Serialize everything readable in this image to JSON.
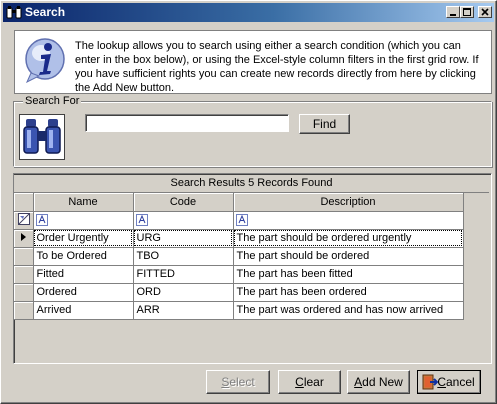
{
  "window": {
    "title": "Search",
    "icon": "binoculars-icon",
    "controls": [
      "minimize-icon",
      "maximize-icon",
      "close-icon"
    ]
  },
  "info": {
    "icon": "info-icon",
    "text": "The lookup allows you to search using either a search condition (which you can enter in the box below), or using the Excel-style column filters in the first grid row. If you have sufficient rights you can create new records directly from here by clicking the Add New button."
  },
  "search": {
    "group_label": "Search For",
    "input_value": "",
    "find_label": "Find",
    "binoculars_icon": "binoculars-icon"
  },
  "results": {
    "header": "Search Results 5 Records Found",
    "columns": [
      "Name",
      "Code",
      "Description"
    ],
    "filter_icon": "filter-icon",
    "rows": [
      {
        "name": "Order Urgently",
        "code": "URG",
        "description": "The part should be ordered urgently"
      },
      {
        "name": "To be Ordered",
        "code": "TBO",
        "description": "The part should be ordered"
      },
      {
        "name": "Fitted",
        "code": "FITTED",
        "description": "The part has been fitted"
      },
      {
        "name": "Ordered",
        "code": "ORD",
        "description": "The part has been ordered"
      },
      {
        "name": "Arrived",
        "code": "ARR",
        "description": "The part was ordered and has now arrived"
      }
    ],
    "current_row": 0
  },
  "buttons": {
    "select": {
      "pre": "",
      "key": "S",
      "post": "elect",
      "enabled": false
    },
    "clear": {
      "pre": "",
      "key": "C",
      "post": "lear",
      "enabled": true
    },
    "add_new": {
      "pre": "",
      "key": "A",
      "post": "dd New",
      "enabled": true
    },
    "cancel": {
      "pre": "",
      "key": "C",
      "post": "ancel",
      "enabled": true,
      "icon": "exit-door-icon"
    }
  },
  "colors": {
    "titlebar_start": "#0a246a",
    "titlebar_end": "#a6caf0",
    "face": "#d4d0c8"
  }
}
